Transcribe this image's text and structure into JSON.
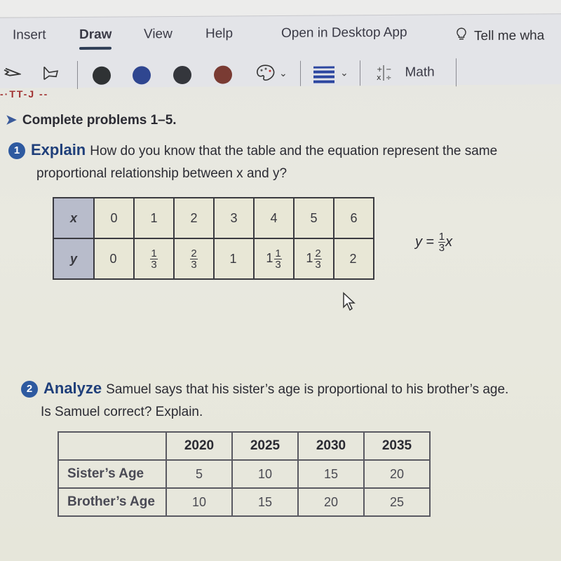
{
  "ribbon": {
    "tabs": [
      {
        "label": "Insert",
        "active": false
      },
      {
        "label": "Draw",
        "active": true
      },
      {
        "label": "View",
        "active": false
      },
      {
        "label": "Help",
        "active": false
      },
      {
        "label": "Open in Desktop App",
        "active": false
      }
    ],
    "tell_me": "Tell me wha",
    "toolbar": {
      "pens": [
        {
          "name": "black",
          "color": "#2f3234"
        },
        {
          "name": "blue",
          "color": "#2f4690"
        },
        {
          "name": "dark-gray",
          "color": "#34363c"
        },
        {
          "name": "brown-red",
          "color": "#7a3b33"
        }
      ],
      "math_label": "Math"
    }
  },
  "content": {
    "partial_heading": "-·TT-J --",
    "instruction": "Complete problems 1–5.",
    "problem1": {
      "number": "1",
      "lead": "Explain",
      "line1": "How do you know that the table and the equation represent the same",
      "line2": "proportional relationship between x and y?",
      "table": {
        "x_label": "x",
        "y_label": "y",
        "x_values": [
          "0",
          "1",
          "2",
          "3",
          "4",
          "5",
          "6"
        ],
        "y_values": [
          {
            "whole": "0"
          },
          {
            "num": "1",
            "den": "3"
          },
          {
            "num": "2",
            "den": "3"
          },
          {
            "whole": "1"
          },
          {
            "whole": "1",
            "num": "1",
            "den": "3"
          },
          {
            "whole": "1",
            "num": "2",
            "den": "3"
          },
          {
            "whole": "2"
          }
        ]
      },
      "equation": {
        "lhs": "y",
        "eq": " = ",
        "num": "1",
        "den": "3",
        "var": "x"
      }
    },
    "problem2": {
      "number": "2",
      "lead": "Analyze",
      "line1": "Samuel says that his sister’s age is proportional to his brother’s age.",
      "line2": "Is Samuel correct? Explain.",
      "table": {
        "years": [
          "2020",
          "2025",
          "2030",
          "2035"
        ],
        "rows": [
          {
            "label": "Sister’s Age",
            "values": [
              "5",
              "10",
              "15",
              "20"
            ]
          },
          {
            "label": "Brother’s Age",
            "values": [
              "10",
              "15",
              "20",
              "25"
            ]
          }
        ]
      }
    }
  }
}
